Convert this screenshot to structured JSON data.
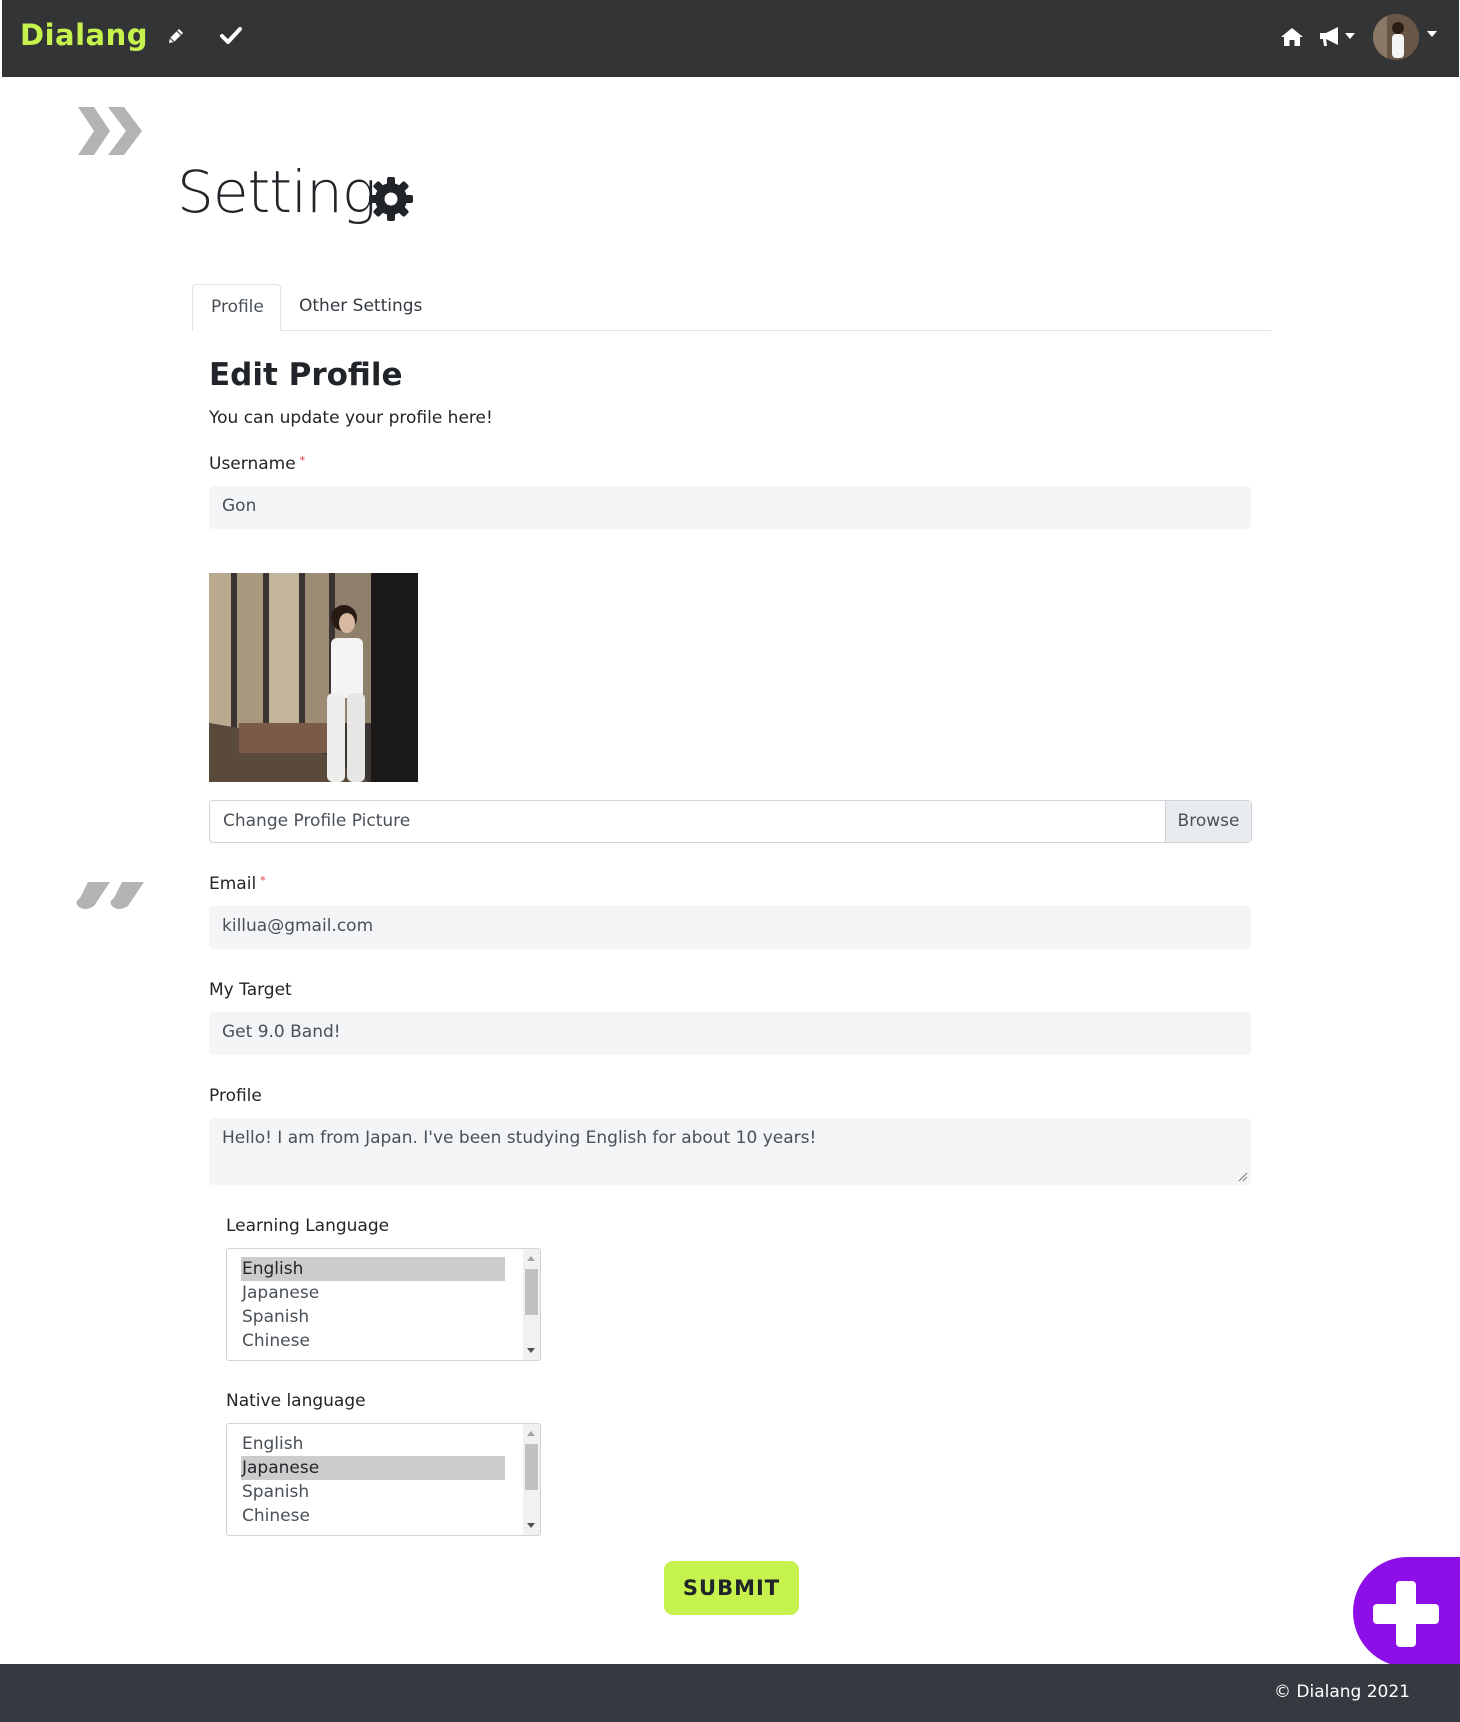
{
  "navbar": {
    "brand": "Dialang",
    "icons": [
      "pencil-icon",
      "check-icon",
      "home-icon",
      "megaphone-icon",
      "user-avatar"
    ]
  },
  "page": {
    "title": "Setting",
    "title_icon": "gear-icon"
  },
  "tabs": [
    {
      "label": "Profile",
      "active": true
    },
    {
      "label": "Other Settings",
      "active": false
    }
  ],
  "form": {
    "heading": "Edit Profile",
    "subheading": "You can update your profile here!",
    "username": {
      "label": "Username",
      "required_mark": "*",
      "value": "Gon"
    },
    "picture": {
      "label": "Change Profile Picture",
      "browse": "Browse"
    },
    "email": {
      "label": "Email",
      "required_mark": "*",
      "value": "killua@gmail.com"
    },
    "target": {
      "label": "My Target",
      "value": "Get 9.0 Band!"
    },
    "profile": {
      "label": "Profile",
      "value": "Hello! I am from Japan. I've been studying English for about 10 years!"
    },
    "learning_language": {
      "label": "Learning Language",
      "options": [
        "English",
        "Japanese",
        "Spanish",
        "Chinese"
      ],
      "selected": "English"
    },
    "native_language": {
      "label": "Native language",
      "options": [
        "English",
        "Japanese",
        "Spanish",
        "Chinese"
      ],
      "selected": "Japanese"
    },
    "submit": "SUBMIT"
  },
  "footer": {
    "text": "© Dialang 2021"
  },
  "colors": {
    "navbar_bg": "#333436",
    "brand": "#c6f24e",
    "submit_bg": "#c6f24e",
    "fab_bg": "#8e0ee8",
    "footer_bg": "#343a40"
  }
}
